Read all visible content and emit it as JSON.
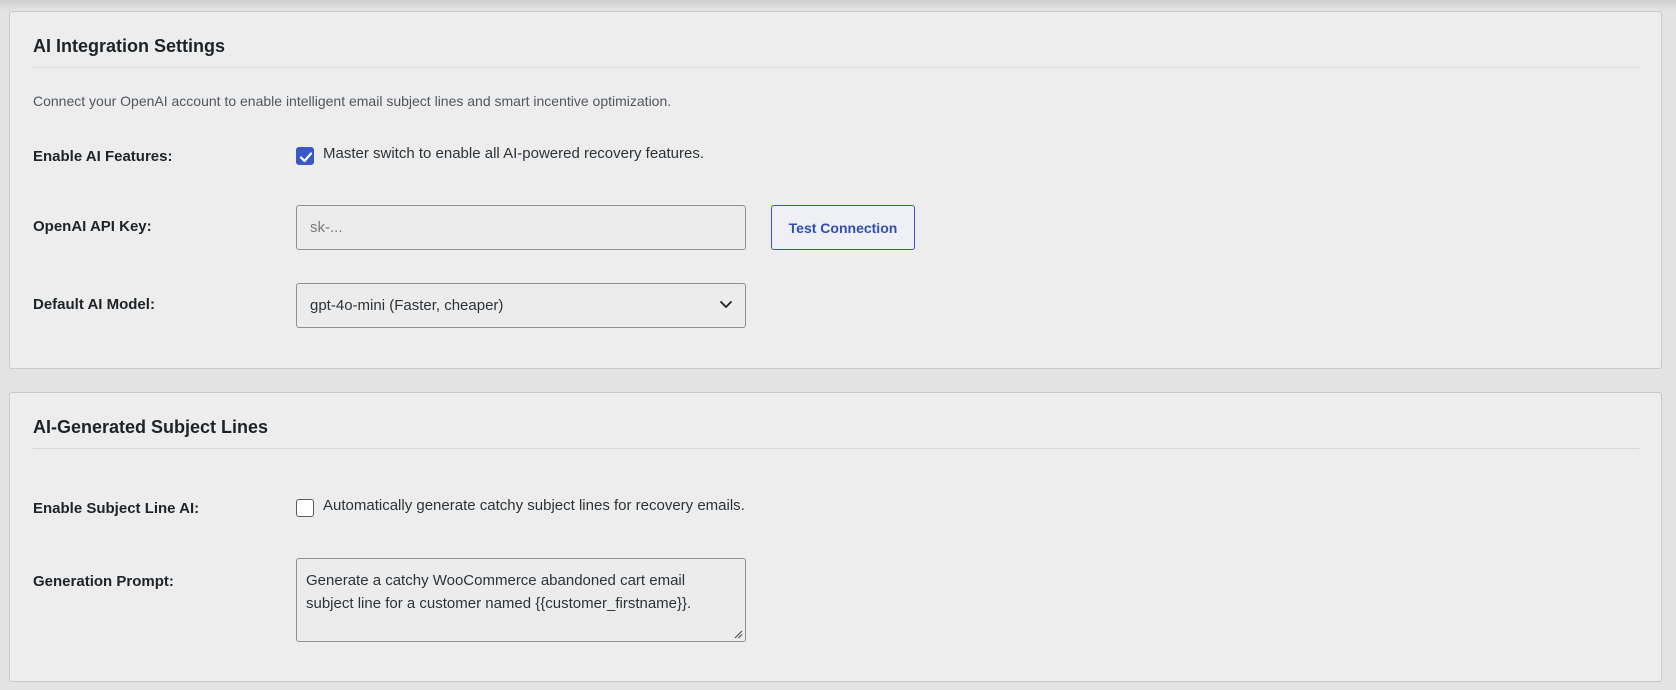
{
  "ai_settings": {
    "title": "AI Integration Settings",
    "description": "Connect your OpenAI account to enable intelligent email subject lines and smart incentive optimization.",
    "enable_ai": {
      "label": "Enable AI Features:",
      "checked": true,
      "text": "Master switch to enable all AI-powered recovery features."
    },
    "api_key": {
      "label": "OpenAI API Key:",
      "value": "",
      "placeholder": "sk-...",
      "test_button": "Test Connection"
    },
    "model": {
      "label": "Default AI Model:",
      "selected": "gpt-4o-mini (Faster, cheaper)"
    }
  },
  "subject_lines": {
    "title": "AI-Generated Subject Lines",
    "enable_subject_ai": {
      "label": "Enable Subject Line AI:",
      "checked": false,
      "text": "Automatically generate catchy subject lines for recovery emails."
    },
    "prompt": {
      "label": "Generation Prompt:",
      "value": "Generate a catchy WooCommerce abandoned cart email subject line for a customer named {{customer_firstname}}."
    }
  },
  "colors": {
    "accent": "#3858c8",
    "panel_bg": "#ededed",
    "page_bg": "#e3e3e3"
  }
}
